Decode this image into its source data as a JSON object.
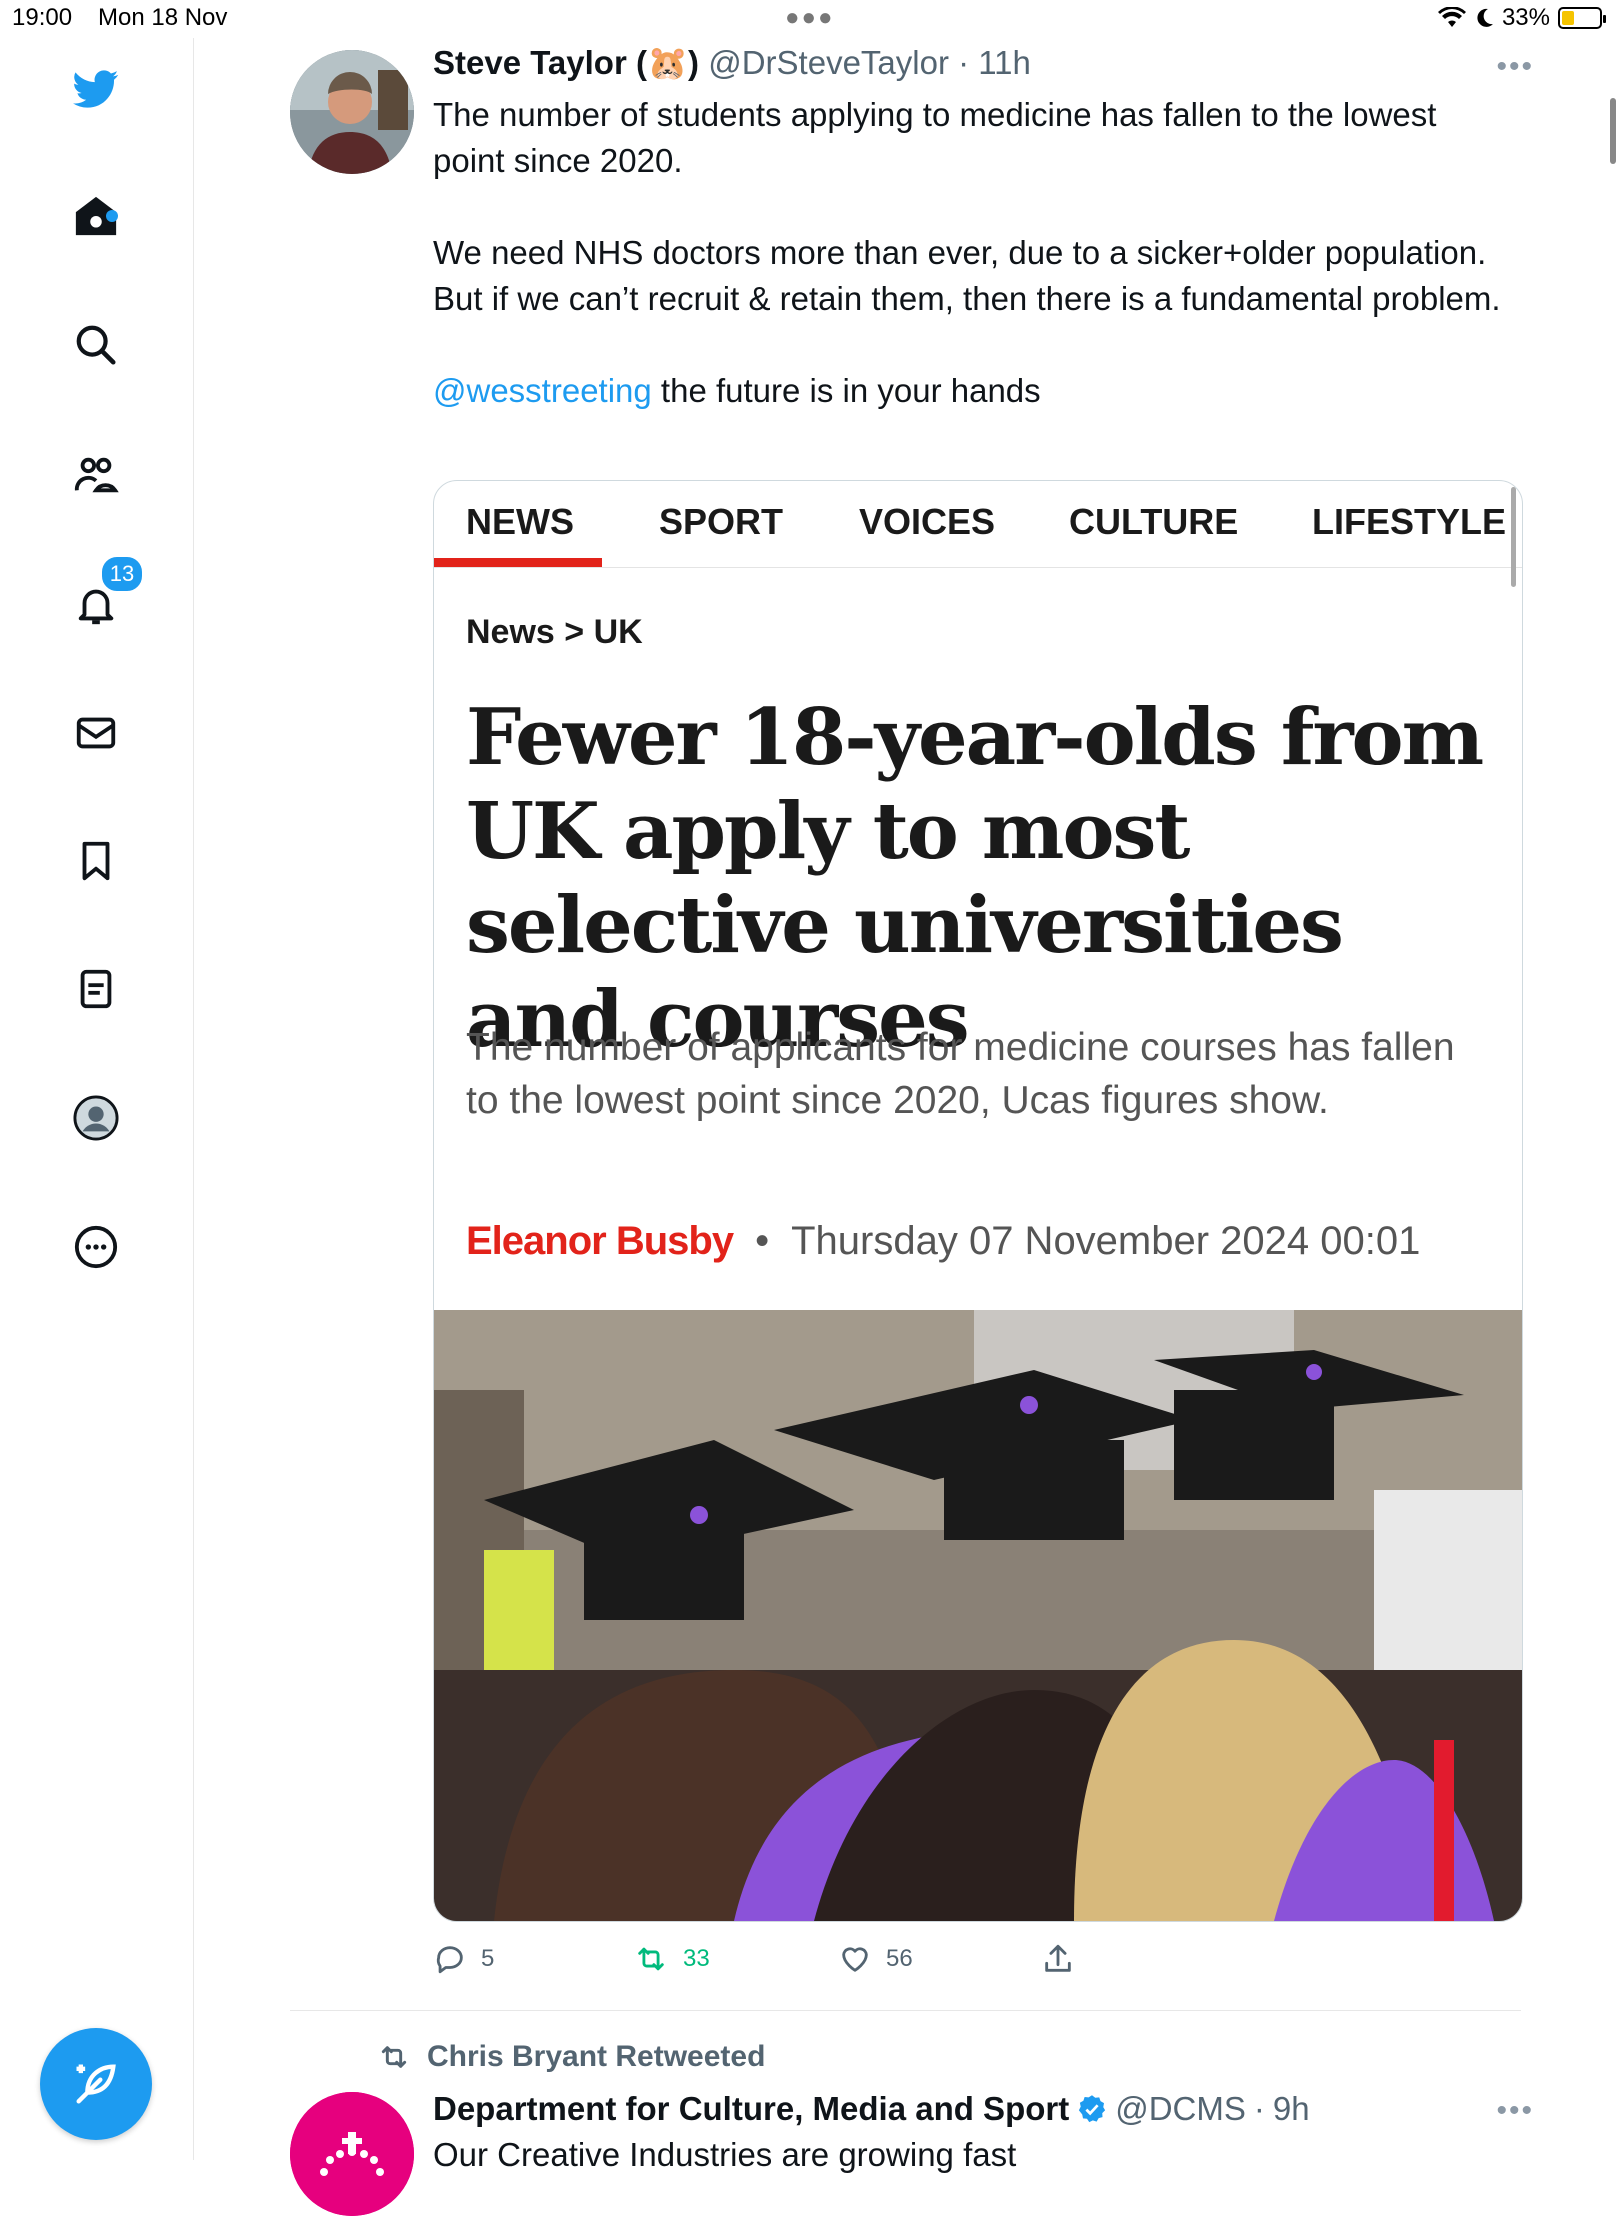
{
  "status_bar": {
    "time": "19:00",
    "date": "Mon 18 Nov",
    "battery_percent": "33%",
    "battery_level": 0.33
  },
  "sidebar": {
    "notifications_badge": "13",
    "icons": [
      "twitter-logo-icon",
      "home-icon",
      "search-icon",
      "communities-icon",
      "notifications-icon",
      "messages-icon",
      "bookmarks-icon",
      "lists-icon",
      "profile-icon",
      "more-icon"
    ]
  },
  "tweet": {
    "author_name": "Steve Taylor (🐹)",
    "handle": "@DrSteveTaylor",
    "time": "11h",
    "text_p1": "The number of students applying to medicine has fallen to the lowest point since 2020.",
    "text_p2": "We need NHS doctors more than ever, due to a sicker+older population. But if we can’t recruit & retain them, then there is a fundamental problem.",
    "mention": "@wesstreeting",
    "text_p3_rest": " the future is in your hands",
    "card": {
      "tabs": [
        "NEWS",
        "SPORT",
        "VOICES",
        "CULTURE",
        "LIFESTYLE"
      ],
      "breadcrumb": "News > UK",
      "headline": "Fewer 18-year-olds from UK apply to most selective universities and courses",
      "standfirst": "The number of applicants for medicine courses has fallen to the lowest point since 2020, Ucas figures show.",
      "author": "Eleanor Busby",
      "separator": "•",
      "date": "Thursday 07 November 2024 00:01"
    },
    "actions": {
      "replies": "5",
      "retweets": "33",
      "likes": "56"
    }
  },
  "next_tweet": {
    "retweeted_by": "Chris Bryant Retweeted",
    "author_name": "Department for Culture, Media and Sport",
    "handle": "@DCMS",
    "time": "9h",
    "text": "Our Creative Industries are growing fast"
  },
  "colors": {
    "accent": "#1d9bf0",
    "retweet_green": "#00ba7c",
    "news_red": "#e2231a",
    "dcms_pink": "#e6007e"
  }
}
